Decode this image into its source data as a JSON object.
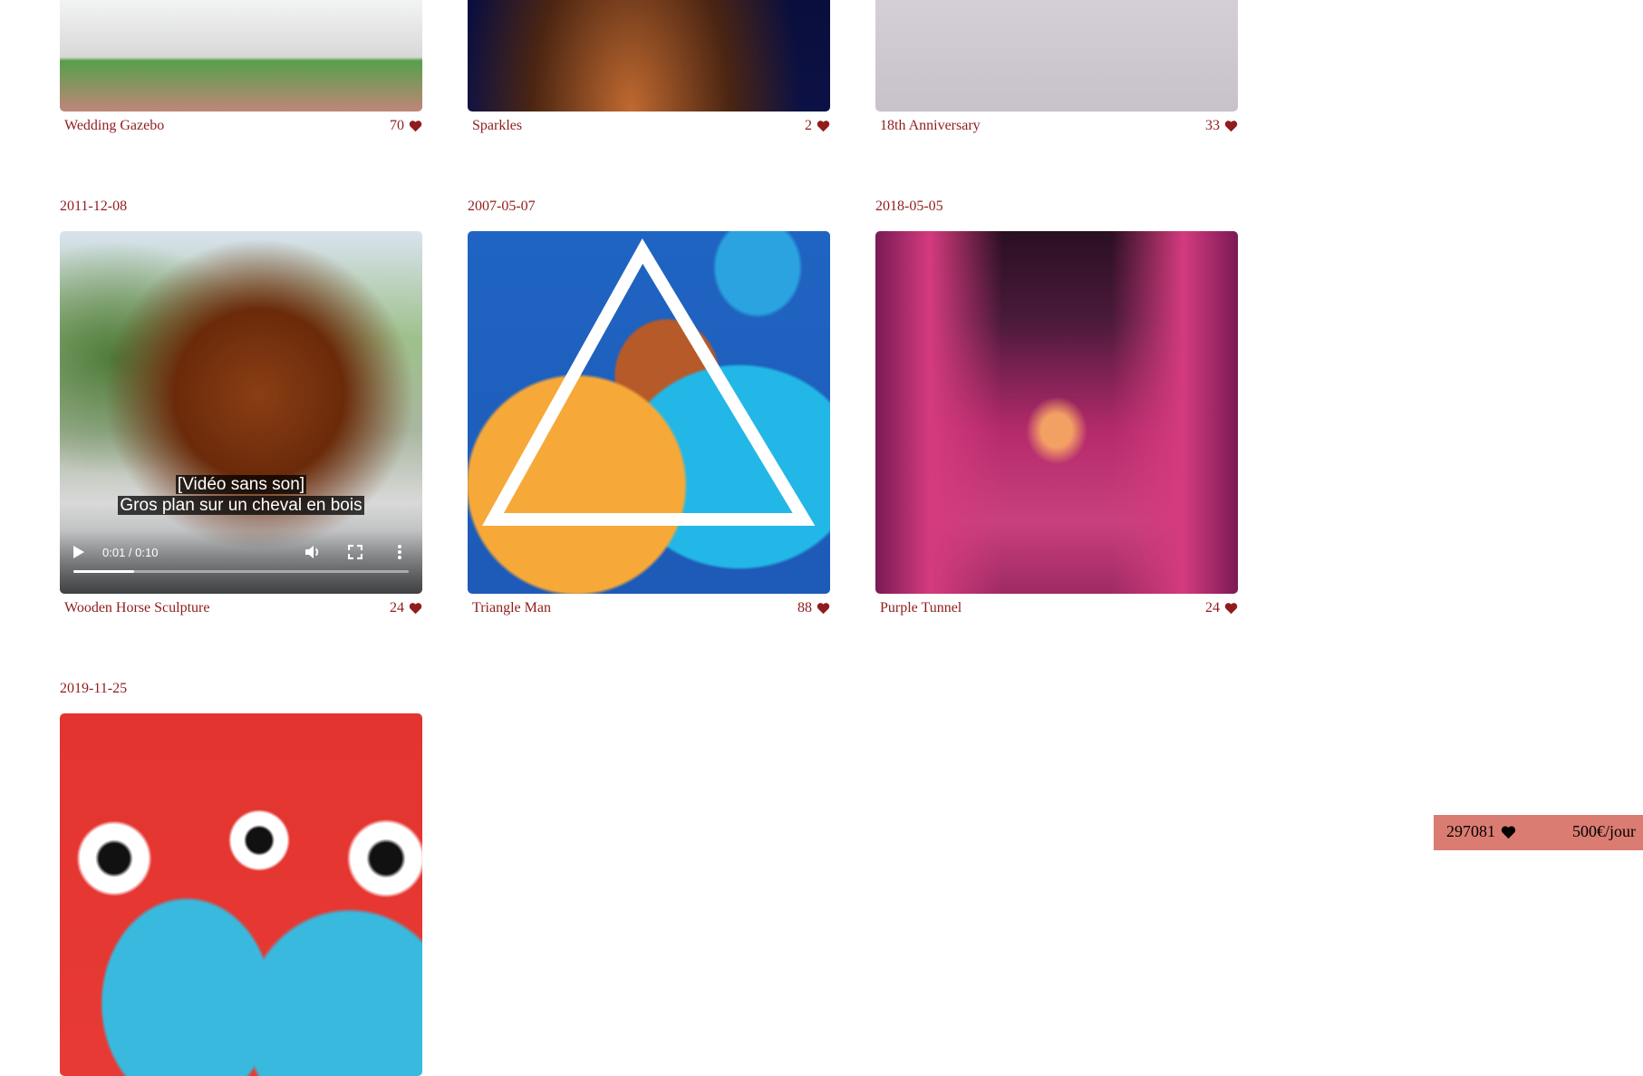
{
  "gallery": [
    {
      "date": "",
      "title": "Wedding Gazebo",
      "likes": "70",
      "media": "photo"
    },
    {
      "date": "",
      "title": "Sparkles",
      "likes": "2",
      "media": "photo"
    },
    {
      "date": "",
      "title": "18th Anniversary",
      "likes": "33",
      "media": "photo"
    },
    {
      "date": "2011-12-08",
      "title": "Wooden Horse Sculpture",
      "likes": "24",
      "media": "video"
    },
    {
      "date": "2007-05-07",
      "title": "Triangle Man",
      "likes": "88",
      "media": "photo"
    },
    {
      "date": "2018-05-05",
      "title": "Purple Tunnel",
      "likes": "24",
      "media": "photo"
    },
    {
      "date": "2019-11-25",
      "title": "",
      "likes": "",
      "media": "photo"
    }
  ],
  "video": {
    "subtitle_line1": "[Vidéo sans son]",
    "subtitle_line2": "Gros plan sur un cheval en bois",
    "time": "0:01 / 0:10",
    "progress_fraction": 0.18
  },
  "summary": {
    "total_likes": "297081",
    "rate": "500€/jour"
  },
  "colors": {
    "accent": "#901c1c",
    "summary_bg": "#db7c72"
  },
  "icons": [
    "heart-icon",
    "play-icon",
    "volume-icon",
    "fullscreen-icon",
    "more-options-icon"
  ]
}
